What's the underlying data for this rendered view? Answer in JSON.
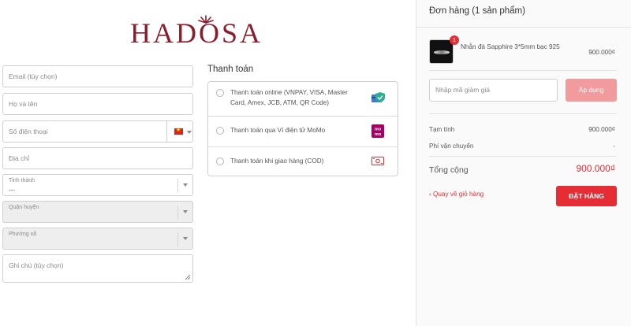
{
  "brand": {
    "logo_text": "HADOSA"
  },
  "form": {
    "email_placeholder": "Email (tùy chọn)",
    "name_placeholder": "Họ và tên",
    "phone_placeholder": "Số điện thoại",
    "address_placeholder": "Địa chỉ",
    "province": {
      "label": "Tỉnh thành",
      "value": "---"
    },
    "district": {
      "label": "Quận huyện"
    },
    "ward": {
      "label": "Phường xã"
    },
    "note_placeholder": "Ghi chú (tùy chọn)"
  },
  "payment": {
    "title": "Thanh toán",
    "options": [
      {
        "label": "Thanh toán online (VNPAY, VISA, Master Card, Amex, JCB, ATM, QR Code)",
        "icon": "card-shield-icon"
      },
      {
        "label": "Thanh toán qua Ví điện tử MoMo",
        "icon": "momo-icon"
      },
      {
        "label": "Thanh toán khi giao hàng (COD)",
        "icon": "cash-icon"
      }
    ]
  },
  "order": {
    "title": "Đơn hàng (1 sản phẩm)",
    "item": {
      "name": "Nhẫn đá Sapphire 3*5mm bạc 925",
      "price": "900.000₫",
      "quantity_badge": "1"
    },
    "coupon_placeholder": "Nhập mã giảm giá",
    "apply_label": "Áp dụng",
    "subtotal_label": "Tạm tính",
    "subtotal_value": "900.000₫",
    "shipping_label": "Phí vận chuyển",
    "shipping_value": "-",
    "total_label": "Tổng cộng",
    "total_value": "900.000₫",
    "back_label": "‹ Quay về giỏ hàng",
    "place_order_label": "ĐẶT HÀNG"
  },
  "colors": {
    "brand": "#8a1c2b",
    "accent": "#e42d34",
    "accent_light": "#f29b9e"
  }
}
